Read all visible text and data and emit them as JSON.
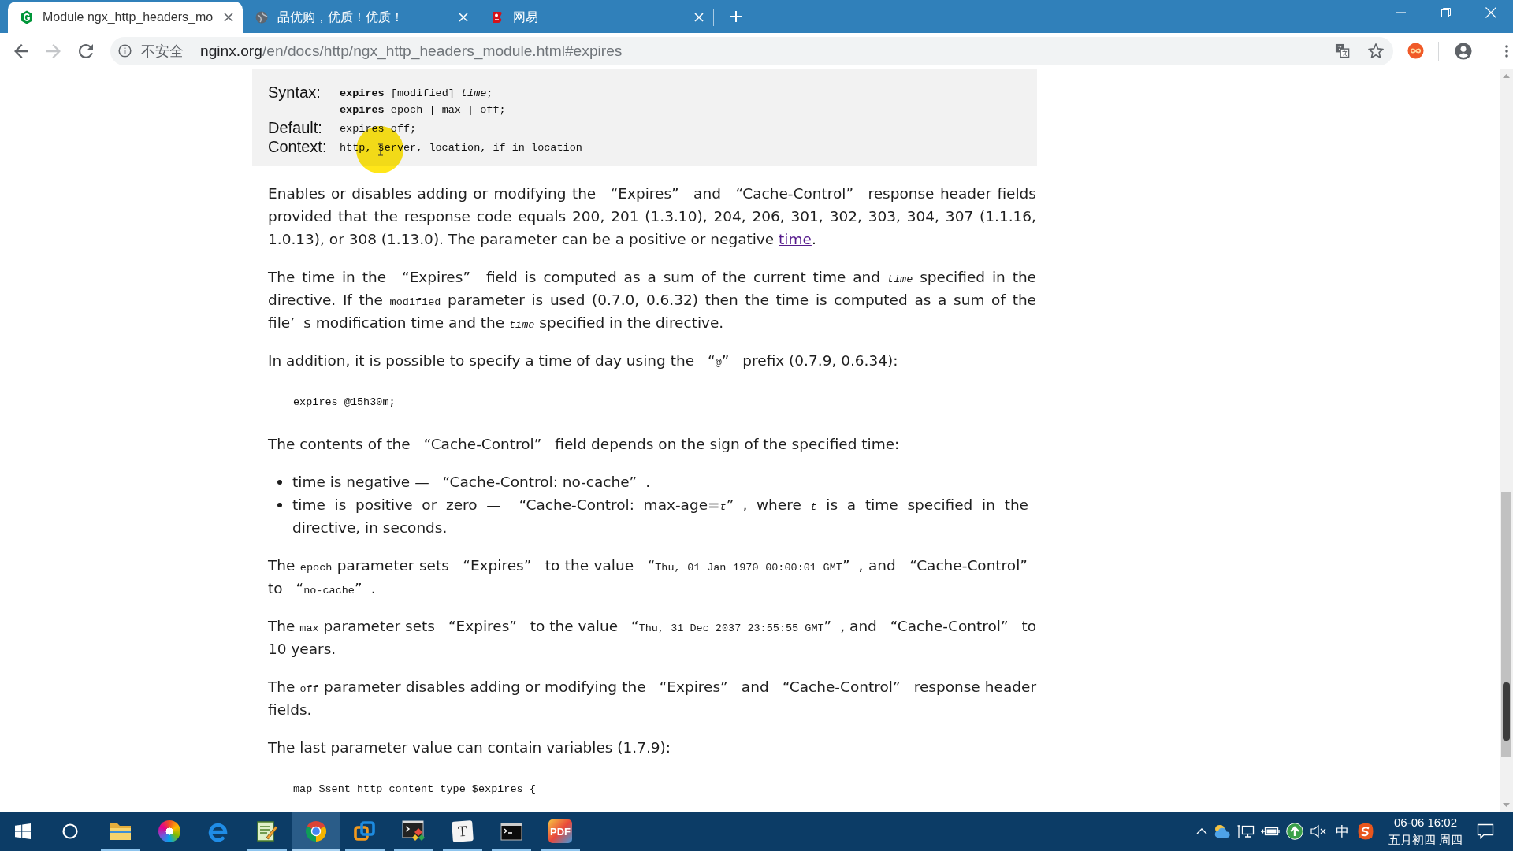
{
  "tabs": [
    {
      "kind": "hexagon",
      "title": "Module ngx_http_headers_mo",
      "selected": true
    },
    {
      "kind": "globe",
      "title": "品优购，优质！优质！",
      "selected": false
    },
    {
      "kind": "swirl",
      "title": "网易",
      "selected": false
    }
  ],
  "nav_buttons": [
    {
      "kind": "back",
      "disabled": false
    },
    {
      "kind": "forward",
      "disabled": true
    },
    {
      "kind": "reload",
      "disabled": false
    }
  ],
  "address_bar": {
    "security_label": "不安全",
    "host": "nginx.org",
    "path": "/en/docs/http/ngx_http_headers_module.html#expires",
    "bookmarked": false
  },
  "directive": [
    {
      "label": "Syntax:",
      "lines": [
        "**expires** [modified] *time*;",
        "**expires** epoch | max | off;"
      ]
    },
    {
      "label": "Default:",
      "lines": [
        "expires off;"
      ]
    },
    {
      "label": "Context:",
      "lines": [
        "http, server, location, if in location"
      ]
    }
  ],
  "content": [
    {
      "kind": "paragraph",
      "runs": [
        {
          "kind": "text",
          "text": "Enables or disables adding or modifying the "
        },
        {
          "kind": "open",
          "text": "“"
        },
        {
          "kind": "text",
          "text": "Expires"
        },
        {
          "kind": "close",
          "text": "”"
        },
        {
          "kind": "text",
          "text": " and "
        },
        {
          "kind": "open",
          "text": "“"
        },
        {
          "kind": "text",
          "text": "Cache-Control"
        },
        {
          "kind": "close",
          "text": "”"
        },
        {
          "kind": "text",
          "text": " response header fields provided that the response code equals 200, 201 (1.3.10), 204, 206, 301, 302, 303, 304, 307 (1.1.16, 1.0.13), or 308 (1.13.0). The parameter can be a positive or negative "
        },
        {
          "kind": "link",
          "text": "time"
        },
        {
          "kind": "text",
          "text": "."
        }
      ]
    },
    {
      "kind": "paragraph",
      "runs": [
        {
          "kind": "text",
          "text": "The time in the "
        },
        {
          "kind": "open",
          "text": "“"
        },
        {
          "kind": "text",
          "text": "Expires"
        },
        {
          "kind": "close",
          "text": "”"
        },
        {
          "kind": "text",
          "text": " field is computed as a sum of the current time and "
        },
        {
          "kind": "var",
          "text": "time"
        },
        {
          "kind": "text",
          "text": " specified in the directive. If the "
        },
        {
          "kind": "code",
          "text": "modified"
        },
        {
          "kind": "text",
          "text": " parameter is used (0.7.0, 0.6.32) then the time is computed as a sum of the file"
        },
        {
          "kind": "close",
          "text": "’"
        },
        {
          "kind": "text",
          "text": "s modification time and the "
        },
        {
          "kind": "var",
          "text": "time"
        },
        {
          "kind": "text",
          "text": " specified in the directive."
        }
      ]
    },
    {
      "kind": "paragraph",
      "runs": [
        {
          "kind": "text",
          "text": "In addition, it is possible to specify a time of day using the "
        },
        {
          "kind": "open",
          "text": "“"
        },
        {
          "kind": "code",
          "text": "@"
        },
        {
          "kind": "close",
          "text": "”"
        },
        {
          "kind": "text",
          "text": " prefix (0.7.9, 0.6.34):"
        }
      ]
    },
    {
      "kind": "code",
      "text": "expires @15h30m;"
    },
    {
      "kind": "paragraph",
      "runs": [
        {
          "kind": "text",
          "text": "The contents of the "
        },
        {
          "kind": "open",
          "text": "“"
        },
        {
          "kind": "text",
          "text": "Cache-Control"
        },
        {
          "kind": "close",
          "text": "”"
        },
        {
          "kind": "text",
          "text": " field depends on the sign of the specified time:"
        }
      ]
    },
    {
      "kind": "list",
      "items": [
        {
          "runs": [
            {
              "kind": "text",
              "text": "time is negative — "
            },
            {
              "kind": "open",
              "text": "“"
            },
            {
              "kind": "text",
              "text": "Cache-Control: no-cache"
            },
            {
              "kind": "close",
              "text": "”"
            },
            {
              "kind": "text",
              "text": "."
            }
          ]
        },
        {
          "runs": [
            {
              "kind": "text",
              "text": "time is positive or zero — "
            },
            {
              "kind": "open",
              "text": "“"
            },
            {
              "kind": "text",
              "text": "Cache-Control: max-age="
            },
            {
              "kind": "var",
              "text": "t"
            },
            {
              "kind": "close",
              "text": "”"
            },
            {
              "kind": "text",
              "text": ", where "
            },
            {
              "kind": "var",
              "text": "t"
            },
            {
              "kind": "text",
              "text": " is a time specified in the directive, in seconds."
            }
          ]
        }
      ]
    },
    {
      "kind": "paragraph",
      "runs": [
        {
          "kind": "text",
          "text": "The "
        },
        {
          "kind": "code",
          "text": "epoch"
        },
        {
          "kind": "text",
          "text": " parameter sets "
        },
        {
          "kind": "open",
          "text": "“"
        },
        {
          "kind": "text",
          "text": "Expires"
        },
        {
          "kind": "close",
          "text": "”"
        },
        {
          "kind": "text",
          "text": " to the value "
        },
        {
          "kind": "open",
          "text": "“"
        },
        {
          "kind": "code",
          "text": "Thu, 01 Jan 1970 00:00:01 GMT"
        },
        {
          "kind": "close",
          "text": "”"
        },
        {
          "kind": "text",
          "text": ", and "
        },
        {
          "kind": "open",
          "text": "“"
        },
        {
          "kind": "text",
          "text": "Cache-Control"
        },
        {
          "kind": "close",
          "text": "”"
        },
        {
          "kind": "text",
          "text": " to "
        },
        {
          "kind": "open",
          "text": "“"
        },
        {
          "kind": "code",
          "text": "no-cache"
        },
        {
          "kind": "close",
          "text": "”"
        },
        {
          "kind": "text",
          "text": "."
        }
      ]
    },
    {
      "kind": "paragraph",
      "runs": [
        {
          "kind": "text",
          "text": "The "
        },
        {
          "kind": "code",
          "text": "max"
        },
        {
          "kind": "text",
          "text": " parameter sets "
        },
        {
          "kind": "open",
          "text": "“"
        },
        {
          "kind": "text",
          "text": "Expires"
        },
        {
          "kind": "close",
          "text": "”"
        },
        {
          "kind": "text",
          "text": " to the value "
        },
        {
          "kind": "open",
          "text": "“"
        },
        {
          "kind": "code",
          "text": "Thu, 31 Dec 2037 23:55:55 GMT"
        },
        {
          "kind": "close",
          "text": "”"
        },
        {
          "kind": "text",
          "text": ", and "
        },
        {
          "kind": "open",
          "text": "“"
        },
        {
          "kind": "text",
          "text": "Cache-Control"
        },
        {
          "kind": "close",
          "text": "”"
        },
        {
          "kind": "text",
          "text": " to 10 years."
        }
      ]
    },
    {
      "kind": "paragraph",
      "runs": [
        {
          "kind": "text",
          "text": "The "
        },
        {
          "kind": "code",
          "text": "off"
        },
        {
          "kind": "text",
          "text": " parameter disables adding or modifying the "
        },
        {
          "kind": "open",
          "text": "“"
        },
        {
          "kind": "text",
          "text": "Expires"
        },
        {
          "kind": "close",
          "text": "”"
        },
        {
          "kind": "text",
          "text": " and "
        },
        {
          "kind": "open",
          "text": "“"
        },
        {
          "kind": "text",
          "text": "Cache-Control"
        },
        {
          "kind": "close",
          "text": "”"
        },
        {
          "kind": "text",
          "text": " response header fields."
        }
      ]
    },
    {
      "kind": "paragraph",
      "runs": [
        {
          "kind": "text",
          "text": "The last parameter value can contain variables (1.7.9):"
        }
      ]
    },
    {
      "kind": "code",
      "text": "map $sent_http_content_type $expires {"
    }
  ],
  "taskbar": {
    "apps": [
      {
        "kind": "folder",
        "running": true,
        "selected": false
      },
      {
        "kind": "pinwheel",
        "running": false,
        "selected": false
      },
      {
        "kind": "ebrowser",
        "running": false,
        "selected": false
      },
      {
        "kind": "notepad",
        "running": true,
        "selected": false
      },
      {
        "kind": "ring",
        "running": true,
        "selected": true
      },
      {
        "kind": "squares",
        "running": true,
        "selected": false
      },
      {
        "kind": "terminal",
        "running": true,
        "selected": false
      },
      {
        "kind": "tile",
        "label": "T",
        "running": true,
        "selected": false
      },
      {
        "kind": "console",
        "running": true,
        "selected": false
      },
      {
        "kind": "badge",
        "label": "PDF",
        "running": true,
        "selected": false
      }
    ],
    "tray": {
      "muted": true,
      "input_method": "中"
    },
    "clock": {
      "time": "06-06 16:02",
      "date": "五月初四 周四"
    }
  }
}
